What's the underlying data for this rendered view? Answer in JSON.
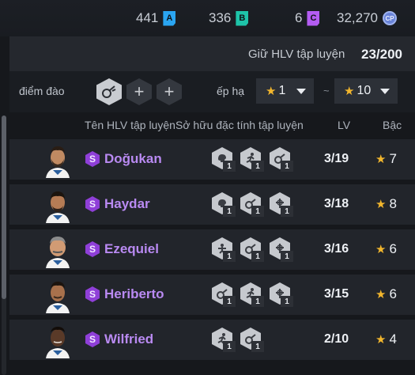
{
  "currency": {
    "a_value": "441",
    "a_label": "A",
    "b_value": "336",
    "b_label": "B",
    "c_value": "6",
    "c_label": "C",
    "cp_value": "32,270",
    "cp_label": "CP"
  },
  "trainer_count": {
    "label": "Giữ HLV tập luyện",
    "value": "23/200"
  },
  "filters": {
    "trait_label": "điểm đào",
    "rank_label": "ếp hạ",
    "rank_min": "1",
    "rank_max": "10",
    "add_symbol": "+",
    "separator": "~"
  },
  "columns": {
    "name": "Tên HLV tập luyện",
    "traits": "Sở hữu đặc tính tập luyện",
    "lv": "LV",
    "rank": "Bậc"
  },
  "colors": {
    "name_purple": "#b98af2",
    "star_gold": "#f2b62d",
    "badge_purple": "#8f3fd8"
  },
  "rows": [
    {
      "grade": "S",
      "name": "Doğukan",
      "lv": "3/19",
      "rank": "7",
      "traits": [
        {
          "icon": "brain-icon",
          "level": "1"
        },
        {
          "icon": "running-icon",
          "level": "1"
        },
        {
          "icon": "ball-icon",
          "level": "1"
        }
      ]
    },
    {
      "grade": "S",
      "name": "Haydar",
      "lv": "3/18",
      "rank": "8",
      "traits": [
        {
          "icon": "brain-icon",
          "level": "1"
        },
        {
          "icon": "ball-icon",
          "level": "1"
        },
        {
          "icon": "target-icon",
          "level": "1"
        }
      ]
    },
    {
      "grade": "S",
      "name": "Ezequiel",
      "lv": "3/16",
      "rank": "6",
      "traits": [
        {
          "icon": "dribble-icon",
          "level": "1"
        },
        {
          "icon": "ball-icon",
          "level": "1"
        },
        {
          "icon": "target-icon",
          "level": "1"
        }
      ]
    },
    {
      "grade": "S",
      "name": "Heriberto",
      "lv": "3/15",
      "rank": "6",
      "traits": [
        {
          "icon": "ball-icon",
          "level": "1"
        },
        {
          "icon": "running-icon",
          "level": "1"
        },
        {
          "icon": "target-icon",
          "level": "1"
        }
      ]
    },
    {
      "grade": "S",
      "name": "Wilfried",
      "lv": "2/10",
      "rank": "4",
      "traits": [
        {
          "icon": "running-icon",
          "level": "1"
        },
        {
          "icon": "ball-icon",
          "level": "1"
        }
      ]
    }
  ]
}
